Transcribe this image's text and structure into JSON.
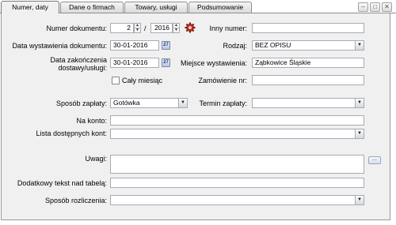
{
  "tabs": [
    {
      "label": "Numer, daty",
      "active": true
    },
    {
      "label": "Dane o firmach",
      "active": false
    },
    {
      "label": "Towary, usługi",
      "active": false
    },
    {
      "label": "Podsumowanie",
      "active": false
    }
  ],
  "form": {
    "numer_dokumentu": {
      "label": "Numer dokumentu:",
      "number": "2",
      "separator": "/",
      "year": "2016"
    },
    "inny_numer": {
      "label": "Inny numer:",
      "value": ""
    },
    "data_wystawienia": {
      "label": "Data wystawienia dokumentu:",
      "value": "30-01-2016"
    },
    "rodzaj": {
      "label": "Rodzaj:",
      "value": "BEZ OPISU"
    },
    "data_zakonczenia": {
      "label_line1": "Data zakończenia",
      "label_line2": "dostawy/usługi:",
      "value": "30-01-2016"
    },
    "miejsce_wystawienia": {
      "label": "Miejsce wystawienia:",
      "value": "Ząbkowice Śląskie"
    },
    "caly_miesiac": {
      "label": "Cały miesiąc",
      "checked": false
    },
    "zamowienie_nr": {
      "label": "Zamówienie nr:",
      "value": ""
    },
    "sposob_zaplaty": {
      "label": "Sposób zapłaty:",
      "value": "Gotówka"
    },
    "termin_zaplaty": {
      "label": "Termin zapłaty:",
      "value": ""
    },
    "na_konto": {
      "label": "Na konto:",
      "value": ""
    },
    "lista_kont": {
      "label": "Lista dostępnych kont:",
      "value": ""
    },
    "uwagi": {
      "label": "Uwagi:",
      "value": ""
    },
    "dodatkowy_tekst": {
      "label": "Dodatkowy tekst nad tabelą:",
      "value": ""
    },
    "sposob_rozliczenia": {
      "label": "Sposób rozliczenia:",
      "value": ""
    }
  },
  "icons": {
    "calendar": "calendar-icon",
    "gear": "gear-icon",
    "ellipsis": "ellipsis-icon"
  }
}
